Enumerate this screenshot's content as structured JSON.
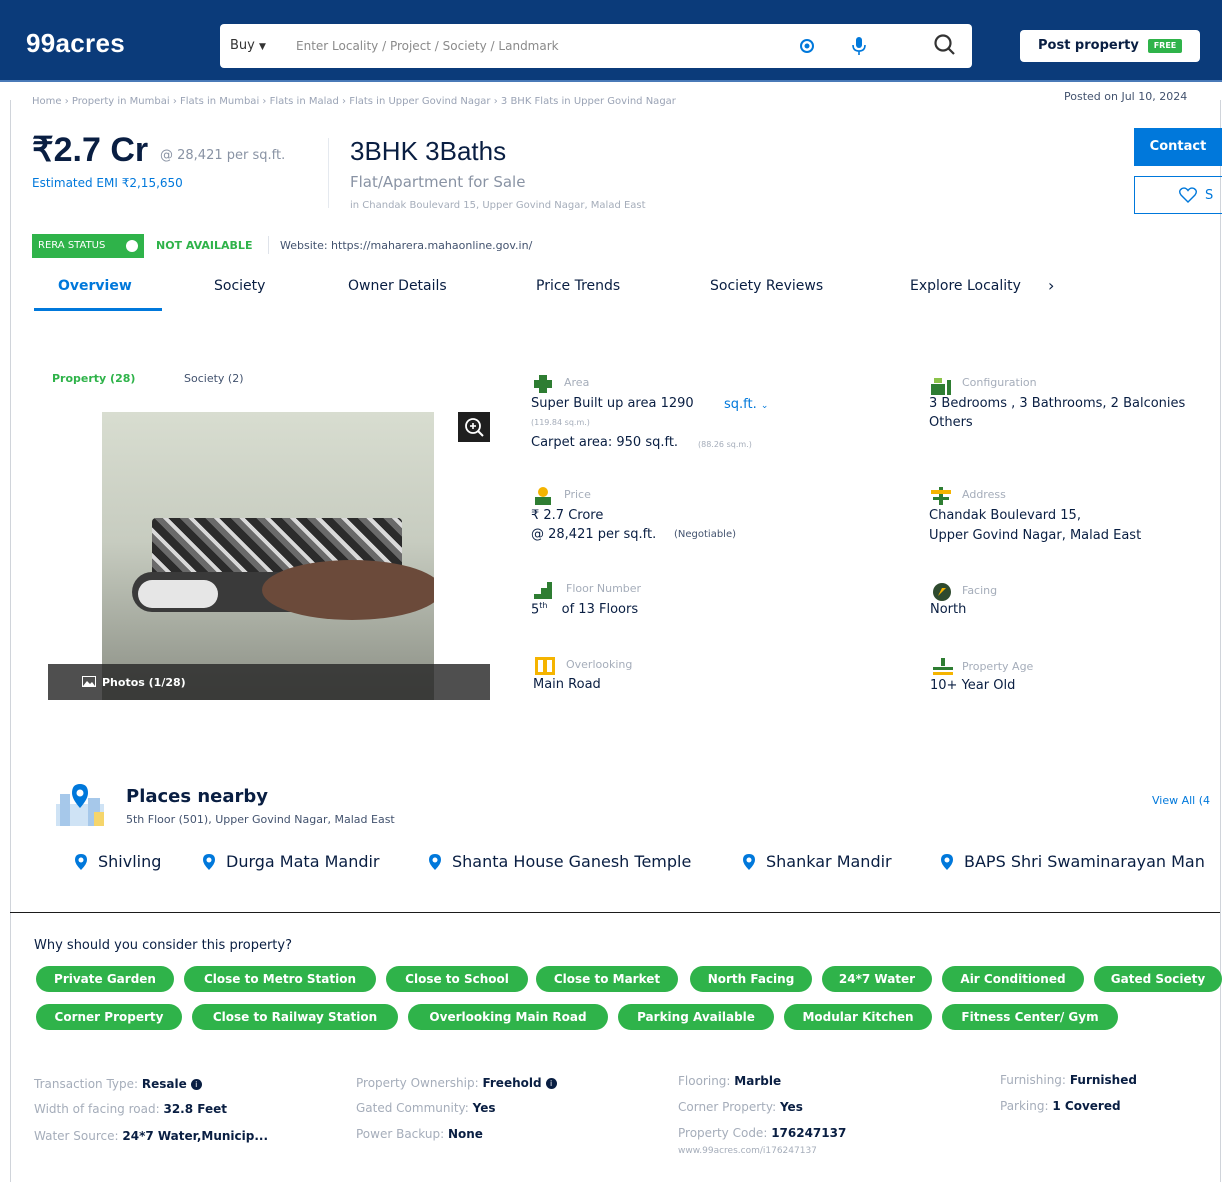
{
  "header": {
    "logo": "99acres",
    "search": {
      "buy_label": "Buy",
      "placeholder": "Enter Locality / Project / Society / Landmark"
    },
    "post_property_label": "Post property",
    "free_badge": "FREE"
  },
  "breadcrumb": "Home › Property in Mumbai › Flats in Mumbai › Flats in Malad › Flats in Upper Govind Nagar › 3 BHK Flats in Upper Govind Nagar",
  "posted_on": "Posted on Jul 10, 2024",
  "price": {
    "main": "₹2.7 Cr",
    "per_sqft": "@ 28,421 per sq.ft.",
    "emi": "Estimated EMI ₹2,15,650"
  },
  "property": {
    "title": "3BHK 3Baths",
    "subtitle": "Flat/Apartment for Sale",
    "location": "in Chandak Boulevard 15, Upper Govind Nagar, Malad East"
  },
  "actions": {
    "contact_label": "Contact",
    "shortlist_label": "S"
  },
  "rera": {
    "badge": "RERA STATUS",
    "status": "NOT AVAILABLE",
    "website": "Website: https://maharera.mahaonline.gov.in/"
  },
  "tabs": [
    {
      "label": "Overview"
    },
    {
      "label": "Society"
    },
    {
      "label": "Owner Details"
    },
    {
      "label": "Price Trends"
    },
    {
      "label": "Society Reviews"
    },
    {
      "label": "Explore Locality"
    }
  ],
  "gallery": {
    "tab_property": "Property (28)",
    "tab_society": "Society (2)",
    "photos_label": "Photos (1/28)"
  },
  "details": {
    "area": {
      "label": "Area",
      "super_built": "Super Built up area 1290",
      "unit": "sq.ft.",
      "super_sqm": "(119.84 sq.m.)",
      "carpet": "Carpet area: 950 sq.ft.",
      "carpet_sqm": "(88.26 sq.m.)"
    },
    "configuration": {
      "label": "Configuration",
      "value": "3 Bedrooms , 3 Bathrooms, 2 Balconies",
      "others": "Others"
    },
    "price": {
      "label": "Price",
      "value": "₹ 2.7 Crore",
      "per_sqft": "@ 28,421 per sq.ft.",
      "negotiable": "(Negotiable)"
    },
    "address": {
      "label": "Address",
      "line1": "Chandak Boulevard 15,",
      "line2": "Upper Govind Nagar, Malad East"
    },
    "floor": {
      "label": "Floor Number",
      "value_num": "5",
      "value_sup": "th",
      "value_rest": "of 13 Floors"
    },
    "facing": {
      "label": "Facing",
      "value": "North"
    },
    "overlooking": {
      "label": "Overlooking",
      "value": "Main Road"
    },
    "age": {
      "label": "Property Age",
      "value": "10+ Year Old"
    }
  },
  "places_nearby": {
    "title": "Places nearby",
    "subtitle": "5th Floor (501), Upper Govind Nagar, Malad East",
    "view_all": "View All (4",
    "places": [
      "Shivling",
      "Durga Mata Mandir",
      "Shanta House Ganesh Temple",
      "Shankar Mandir",
      "BAPS Shri Swaminarayan Man"
    ]
  },
  "why_consider": {
    "title": "Why should you consider this property?",
    "chips": [
      "Private Garden",
      "Close to Metro Station",
      "Close to School",
      "Close to Market",
      "North Facing",
      "24*7 Water",
      "Air Conditioned",
      "Gated Society",
      "Corner Property",
      "Close to Railway Station",
      "Overlooking Main Road",
      "Parking Available",
      "Modular Kitchen",
      "Fitness Center/ Gym"
    ]
  },
  "facts": {
    "transaction": {
      "k": "Transaction Type:",
      "v": "Resale"
    },
    "facing_road": {
      "k": "Width of facing road:",
      "v": "32.8 Feet"
    },
    "water": {
      "k": "Water Source:",
      "v": "24*7 Water,Municip..."
    },
    "ownership": {
      "k": "Property Ownership:",
      "v": "Freehold"
    },
    "gated": {
      "k": "Gated Community:",
      "v": "Yes"
    },
    "power": {
      "k": "Power Backup:",
      "v": "None"
    },
    "flooring": {
      "k": "Flooring:",
      "v": "Marble"
    },
    "corner": {
      "k": "Corner Property:",
      "v": "Yes"
    },
    "code": {
      "k": "Property Code:",
      "v": "176247137"
    },
    "code_url": "www.99acres.com/i176247137",
    "furnishing": {
      "k": "Furnishing:",
      "v": "Furnished"
    },
    "parking": {
      "k": "Parking:",
      "v": "1 Covered"
    }
  },
  "colors": {
    "header_bg": "#0b3b7a",
    "accent_blue": "#0078db",
    "accent_green": "#2fb34a",
    "text_dark": "#091e42",
    "text_muted": "#a5adba"
  }
}
